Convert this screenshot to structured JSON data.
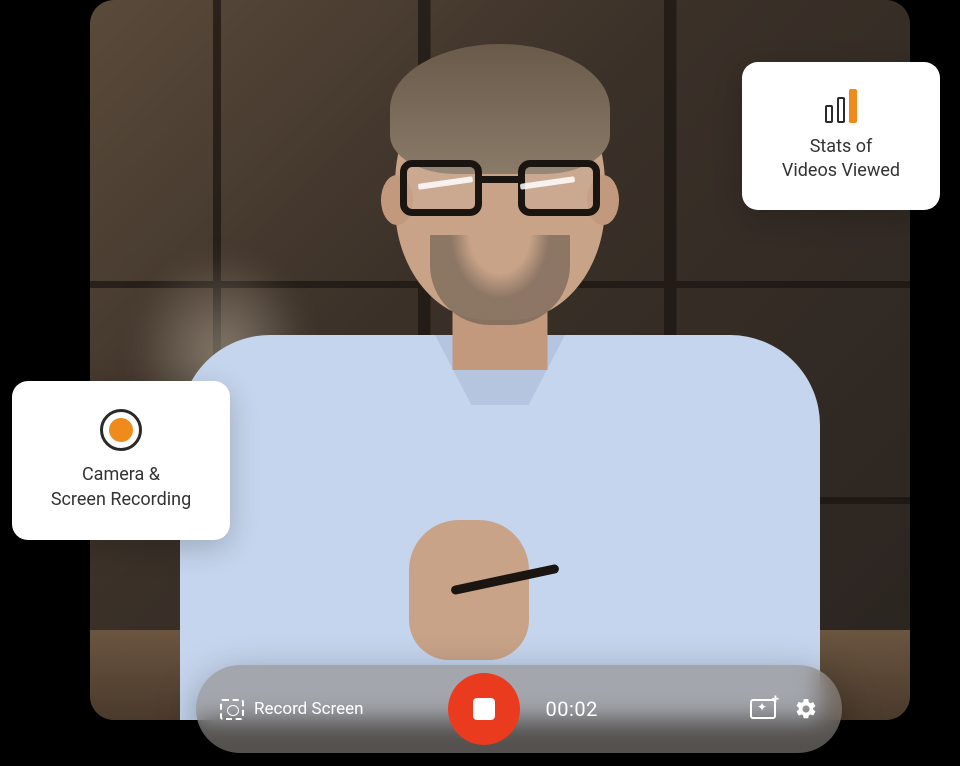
{
  "cards": {
    "stats": {
      "line1": "Stats of",
      "line2": "Videos Viewed"
    },
    "camera": {
      "line1": "Camera &",
      "line2": "Screen Recording"
    }
  },
  "toolbar": {
    "record_label": "Record Screen",
    "timer": "00:02"
  },
  "colors": {
    "accent_orange": "#ef8a1c",
    "record_red": "#ea3b1f"
  }
}
